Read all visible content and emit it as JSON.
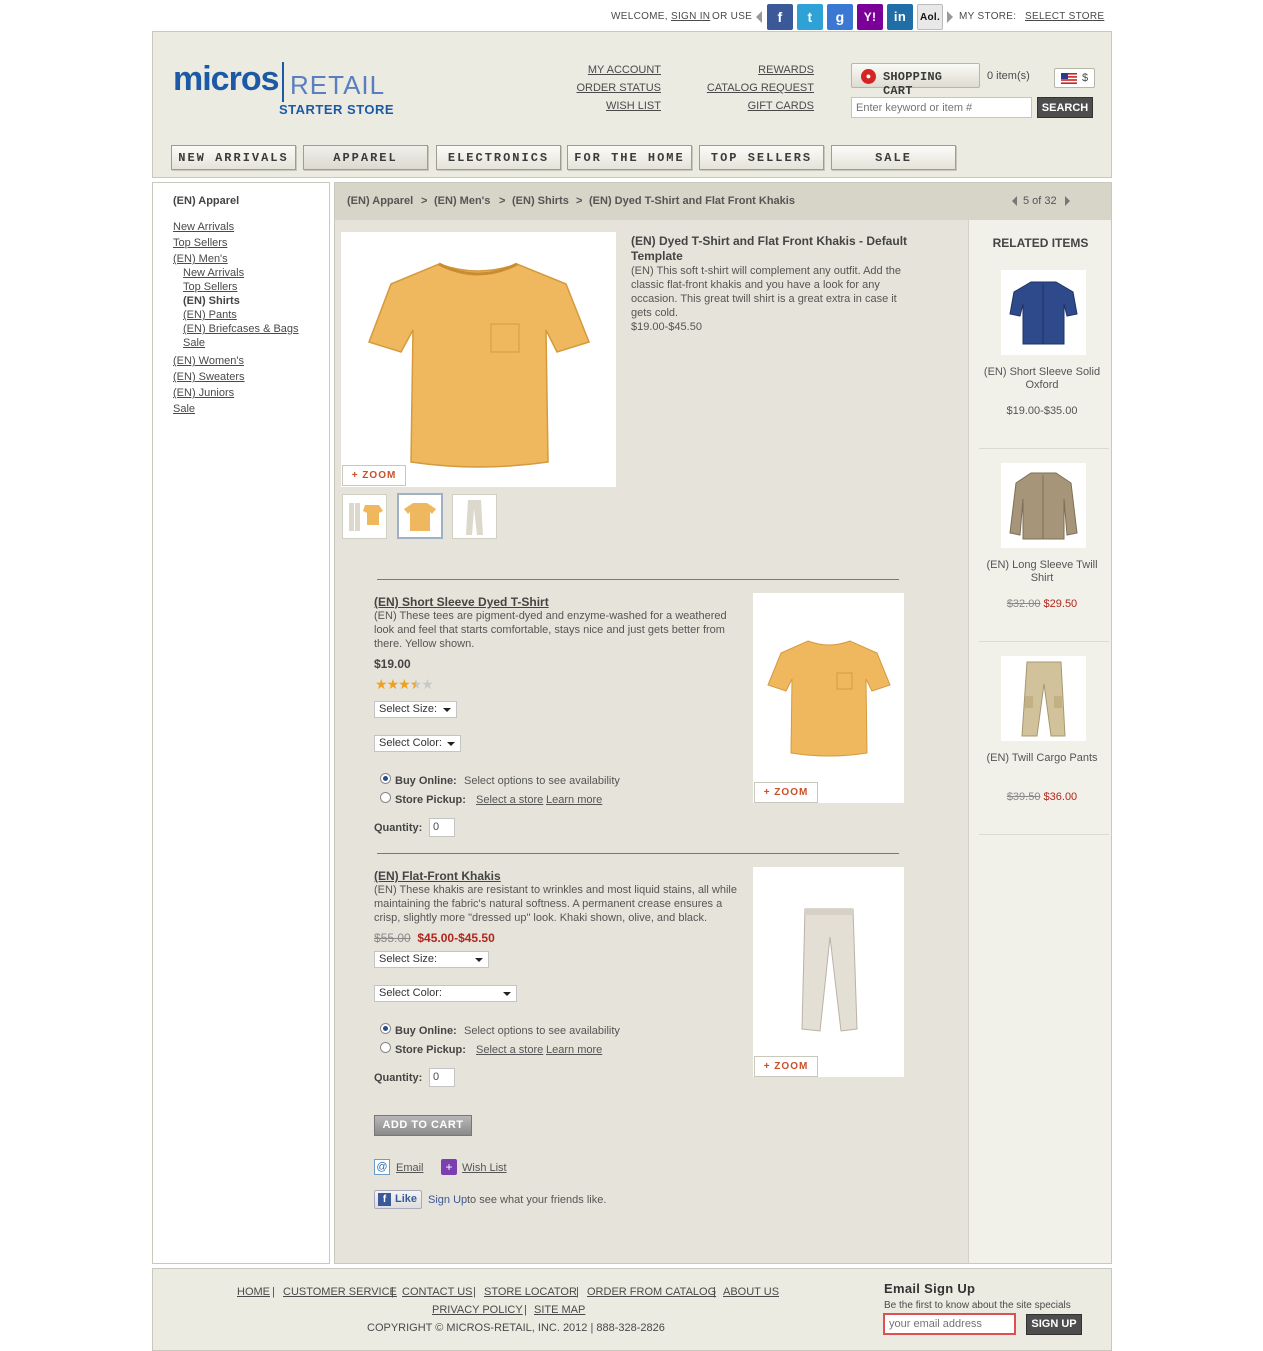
{
  "topbar": {
    "welcome": "WELCOME,",
    "sign_in": "SIGN IN",
    "or_use": "OR USE",
    "social": [
      {
        "label": "f",
        "color": "#3b5998",
        "icon": "facebook-icon"
      },
      {
        "label": "t",
        "color": "#2ea1d6",
        "icon": "twitter-icon"
      },
      {
        "label": "g",
        "color": "#3a78d4",
        "icon": "google-icon"
      },
      {
        "label": "Y!",
        "color": "#7b0099",
        "icon": "yahoo-icon"
      },
      {
        "label": "in",
        "color": "#1f6ea8",
        "icon": "linkedin-icon"
      },
      {
        "label": "Aol.",
        "color": "#e8e8e8",
        "icon": "aol-icon"
      }
    ],
    "my_store": "MY STORE:",
    "select_store": "SELECT STORE"
  },
  "header": {
    "logo_micros": "micros",
    "logo_retail": "RETAIL",
    "logo_sub": "STARTER STORE",
    "links": {
      "my_account": "MY ACCOUNT",
      "order_status": "ORDER STATUS",
      "wish_list": "WISH LIST",
      "rewards": "REWARDS",
      "catalog_request": "CATALOG REQUEST",
      "gift_cards": "GIFT CARDS"
    },
    "cart_label": "SHOPPING CART",
    "cart_count": "0 item(s)",
    "currency": "$",
    "search_placeholder": "Enter keyword or item #",
    "search_button": "SEARCH"
  },
  "nav": [
    "NEW ARRIVALS",
    "APPAREL",
    "ELECTRONICS",
    "FOR THE HOME",
    "TOP SELLERS",
    "SALE"
  ],
  "leftnav": {
    "title": "(EN) Apparel",
    "items": [
      "New Arrivals",
      "Top Sellers",
      "(EN) Men's"
    ],
    "sub": [
      "New Arrivals",
      "Top Sellers",
      "(EN) Shirts",
      "(EN) Pants",
      "(EN) Briefcases & Bags",
      "Sale"
    ],
    "items2": [
      "(EN) Women's",
      "(EN) Sweaters",
      "(EN) Juniors",
      "Sale"
    ]
  },
  "breadcrumb": {
    "items": [
      "(EN) Apparel",
      "(EN) Men's",
      "(EN) Shirts",
      "(EN) Dyed T-Shirt and Flat Front Khakis"
    ],
    "sep": ">",
    "pager": "5 of 32"
  },
  "bundle": {
    "title": "(EN) Dyed T-Shirt and Flat Front Khakis - Default Template",
    "desc": "(EN) This soft t-shirt will complement any outfit. Add the classic flat-front khakis and you have a look for any occasion. This great twill shirt is a great extra in case it gets cold.",
    "price": "$19.00-$45.50",
    "zoom": "+ ZOOM"
  },
  "products": [
    {
      "name": "(EN) Short Sleeve Dyed T-Shirt",
      "desc": "(EN) These tees are pigment-dyed and enzyme-washed for a weathered look and feel that starts comfortable, stays nice and just gets better from there. Yellow shown.",
      "price": "$19.00",
      "rating": 3.5,
      "size": "Select Size:",
      "color": "Select Color:",
      "buy_online": "Buy Online:",
      "buy_online_note": "Select options to see availability",
      "store_pickup": "Store Pickup:",
      "select_store": "Select a store",
      "learn_more": "Learn more",
      "quantity_label": "Quantity:",
      "quantity": "0",
      "zoom": "+ ZOOM"
    },
    {
      "name": "(EN) Flat-Front Khakis",
      "desc": "(EN) These khakis are resistant to wrinkles and most liquid stains, all while maintaining the fabric's natural softness. A permanent crease ensures a crisp, slightly more \"dressed up\" look. Khaki shown, olive, and black.",
      "old_price": "$55.00",
      "price": "$45.00-$45.50",
      "size": "Select Size:",
      "color": "Select Color:",
      "buy_online": "Buy Online:",
      "buy_online_note": "Select options to see availability",
      "store_pickup": "Store Pickup:",
      "select_store": "Select a store",
      "learn_more": "Learn more",
      "quantity_label": "Quantity:",
      "quantity": "0",
      "zoom": "+ ZOOM"
    }
  ],
  "actions": {
    "add_to_cart": "ADD TO CART",
    "email": "Email",
    "wish_list": "Wish List",
    "like": "Like",
    "sign_up": "Sign Up",
    "like_text": "to see what your friends like."
  },
  "related": {
    "title": "RELATED ITEMS",
    "items": [
      {
        "name": "(EN) Short Sleeve Solid Oxford",
        "price": "$19.00-$35.00"
      },
      {
        "name": "(EN) Long Sleeve Twill Shirt",
        "old_price": "$32.00",
        "price": "$29.50"
      },
      {
        "name": "(EN) Twill Cargo Pants",
        "old_price": "$39.50",
        "price": "$36.00"
      }
    ]
  },
  "footer": {
    "links": [
      "HOME",
      "CUSTOMER SERVICE",
      "CONTACT US",
      "STORE LOCATOR",
      "ORDER FROM CATALOG",
      "ABOUT US"
    ],
    "links2": [
      "PRIVACY POLICY",
      "SITE MAP"
    ],
    "copyright": "COPYRIGHT © MICROS-RETAIL, INC. 2012 | 888-328-2826",
    "signup_title": "Email Sign Up",
    "signup_sub": "Be the first to know about the site specials",
    "email_placeholder": "your email address",
    "signup_button": "SIGN UP"
  },
  "colors": {
    "brand_blue": "#1d5aa6",
    "header_bg": "#ecebe2",
    "main_bg": "#e6e4da",
    "sale_red": "#b0261e",
    "zoom_orange": "#c8502a",
    "star": "#f0a020"
  }
}
